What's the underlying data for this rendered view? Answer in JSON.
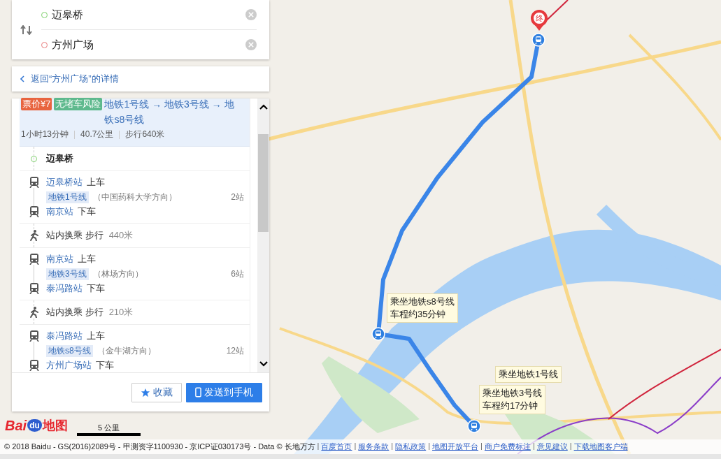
{
  "search": {
    "origin": "迈皋桥",
    "destination": "方州广场"
  },
  "back_link": "返回“方州广场”的详情",
  "route": {
    "badges": [
      {
        "text": "票价¥7",
        "color": "#e8643f"
      },
      {
        "text": "无堵车风险",
        "color": "#5eb98d"
      }
    ],
    "title": "地铁1号线 → 地铁3号线 → 地铁s8号线",
    "stats": [
      "1小时13分钟",
      "40.7公里",
      "步行640米"
    ]
  },
  "steps": [
    {
      "kind": "start",
      "name": "迈皋桥"
    },
    {
      "kind": "ride",
      "board_station": "迈皋桥站",
      "board_action": "上车",
      "line": "地铁1号线",
      "direction": "（中国药科大学方向）",
      "stops": "2站",
      "alight_station": "南京站",
      "alight_action": "下车"
    },
    {
      "kind": "walk",
      "text": "站内换乘 步行",
      "distance": "440米"
    },
    {
      "kind": "ride",
      "board_station": "南京站",
      "board_action": "上车",
      "line": "地铁3号线",
      "direction": "（林场方向）",
      "stops": "6站",
      "alight_station": "泰冯路站",
      "alight_action": "下车"
    },
    {
      "kind": "walk",
      "text": "站内换乘 步行",
      "distance": "210米"
    },
    {
      "kind": "ride",
      "board_station": "泰冯路站",
      "board_action": "上车",
      "line": "地铁s8号线",
      "direction": "（金牛湖方向）",
      "stops": "12站",
      "alight_station": "方州广场站",
      "alight_action": "下车"
    }
  ],
  "buttons": [
    {
      "kind": "favorite",
      "label": "收藏"
    },
    {
      "kind": "send",
      "label": "发送到手机"
    }
  ],
  "map": {
    "end_marker": "终",
    "callouts": [
      {
        "lines": [
          "乘坐地铁s8号线",
          "车程约35分钟"
        ]
      },
      {
        "lines": [
          "乘坐地铁1号线"
        ]
      },
      {
        "lines": [
          "乘坐地铁3号线",
          "车程约17分钟"
        ]
      }
    ]
  },
  "logo": {
    "part_1": "Bai",
    "part_2": "du",
    "part_3": "地图"
  },
  "scale": "5 公里",
  "footer": {
    "separator": "|",
    "copyright": "© 2018 Baidu - GS(2016)2089号 - 甲测资字1100930 - 京ICP证030173号 - Data © 长地万方",
    "links": [
      "百度首页",
      "服务条款",
      "隐私政策",
      "地图开放平台",
      "商户免费标注",
      "意见建议",
      "下载地图客户端"
    ]
  }
}
